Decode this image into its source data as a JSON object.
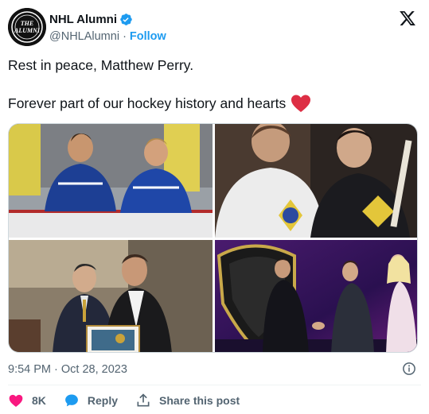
{
  "account": {
    "display_name": "NHL Alumni",
    "handle": "@NHLAlumni",
    "separator": "·",
    "follow_label": "Follow",
    "avatar_text_top": "THE",
    "avatar_text_bottom": "ALUMNI"
  },
  "post": {
    "line1": "Rest in peace, Matthew Perry.",
    "line2": "Forever part of our hockey history and hearts"
  },
  "media": {
    "images": [
      {
        "name": "photo-hockey-bench"
      },
      {
        "name": "photo-vintage-jerseys"
      },
      {
        "name": "photo-award-portrait"
      },
      {
        "name": "photo-nhl-stage"
      }
    ]
  },
  "meta": {
    "timestamp": "9:54 PM · Oct 28, 2023"
  },
  "actions": {
    "like_count": "8K",
    "reply_label": "Reply",
    "share_label": "Share this post"
  },
  "colors": {
    "accent": "#1d9bf0",
    "like": "#f91880",
    "heart_emoji": "#dd2e44",
    "muted": "#536471"
  },
  "icons": [
    "verified-badge-icon",
    "x-logo-icon",
    "red-heart-icon",
    "info-icon",
    "heart-icon",
    "reply-bubble-icon",
    "share-upload-icon"
  ]
}
